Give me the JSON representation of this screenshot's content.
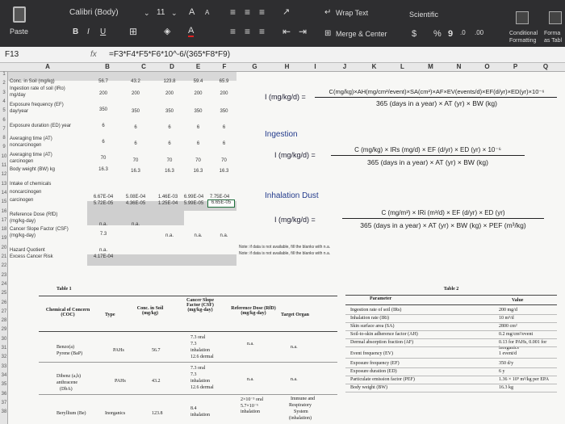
{
  "ribbon": {
    "paste_label": "Paste",
    "font_name": "Calibri (Body)",
    "font_size": "11",
    "grow_font": "A",
    "shrink_font": "A",
    "bold": "B",
    "italic": "I",
    "underline": "U",
    "wrap_text": "Wrap Text",
    "merge_center": "Merge & Center",
    "number_format": "Scientific",
    "currency": "$",
    "percent": "%",
    "comma": "9",
    "conditional_formatting_1": "Conditional",
    "conditional_formatting_2": "Formatting",
    "format_as_table_1": "Forma",
    "format_as_table_2": "as Tabl"
  },
  "formula_bar": {
    "cell_ref": "F13",
    "fx": "fx",
    "formula": "=F3*F4*F5*F6*10^-6/(365*F8*F9)"
  },
  "columns": [
    "A",
    "B",
    "C",
    "D",
    "E",
    "F",
    "G",
    "H",
    "I",
    "J",
    "K",
    "L",
    "M",
    "N",
    "O",
    "P",
    "Q"
  ],
  "rows": [
    "1",
    "2",
    "3",
    "4",
    "5",
    "6",
    "7",
    "8",
    "9",
    "10",
    "11",
    "12",
    "13",
    "14",
    "15",
    "16",
    "17",
    "18",
    "19",
    "20",
    "21",
    "22",
    "23",
    "24",
    "25",
    "26",
    "27",
    "28",
    "29",
    "30",
    "31",
    "32",
    "33",
    "34",
    "35",
    "36",
    "37",
    "38"
  ],
  "labels": {
    "r2": "Conc. in Soil (mg/kg)",
    "r3a": "Ingestion rate of soil (IRo)",
    "r3b": "mg/day",
    "r4a": "Exposure frequency (EF)",
    "r4b": "day/year",
    "r6": "Exposure duration (ED) year",
    "r7a": "Averaging time (AT)",
    "r7b": "noncarcinogen",
    "r8a": "Averaging time (AT)",
    "r8b": "carcinogen",
    "r9": "Body weight (BW) kg",
    "r11": "Intake of chemicals",
    "r12": "noncarcinogen",
    "r13": "carcinogen",
    "r15a": "Reference Dose (RfD)",
    "r15b": "(mg/kg-day)",
    "r16a": "Cancer Slope Factor (CSF)",
    "r16b": "(mg/kg-day)",
    "r18": "Hazard Quotient",
    "r19": "Excess Cancer Risk"
  },
  "values": {
    "r2": [
      "56.7",
      "43.2",
      "123.8",
      "59.4",
      "65.9"
    ],
    "r3": [
      "200",
      "200",
      "200",
      "200",
      "200"
    ],
    "r4": [
      "350",
      "350",
      "350",
      "350",
      "350"
    ],
    "r6": [
      "6",
      "6",
      "6",
      "6",
      "6"
    ],
    "r7": [
      "6",
      "6",
      "6",
      "6",
      "6"
    ],
    "r8": [
      "70",
      "70",
      "70",
      "70",
      "70"
    ],
    "r9": [
      "16.3",
      "16.3",
      "16.3",
      "16.3",
      "16.3"
    ],
    "r12": [
      "6.67E-04",
      "5.08E-04",
      "1.46E-03",
      "6.99E-04",
      "7.75E-04"
    ],
    "r13": [
      "5.72E-05",
      "4.36E-05",
      "1.25E-04",
      "5.99E-05",
      "6.65E-05"
    ],
    "r15": [
      "n.a.",
      "n.a."
    ],
    "r16": [
      "7.3",
      "n.a.",
      "n.a.",
      "n.a."
    ],
    "r18": "n.a.",
    "r19": "4.17E-04"
  },
  "notes": {
    "n1": "Note: if data is not available, fill the blanks with n.a.",
    "n2": "Note: if data is not available, fill the blanks with n.a."
  },
  "equations": {
    "main_lhs": "I (mg/kg/d) =",
    "main_num": "C(mg/kg)×AH(mg/cm²/event)×SA(cm²)×AF×EV(events/d)×EF(d/yr)×ED(yr)×10⁻⁶",
    "main_den": "365 (days in a year) × AT (yr) × BW (kg)",
    "ingestion_title": "Ingestion",
    "ing_lhs": "I (mg/kg/d) =",
    "ing_num": "C (mg/kg) × IRs (mg/d) × EF (d/yr) × ED (yr) × 10⁻⁶",
    "ing_den": "365 (days in a year) × AT (yr) × BW (kg)",
    "inhal_title": "Inhalation Dust",
    "inh_lhs": "I (mg/kg/d) =",
    "inh_num": "C (mg/m³) × IRi (m³/d) × EF (d/yr) × ED (yr)",
    "inh_den": "365 (days in a year) × AT (yr) × BW (kg) × PEF (m³/kg)"
  },
  "table1": {
    "title": "Table 1",
    "h_chem": "Chemical of Concern (COC)",
    "h_type": "Type",
    "h_conc": "Conc. in Soil (mg/kg)",
    "h_csf": "Cancer Slope Factor (CSF) (mg/kg-day)",
    "h_rfd": "Reference Dose (RfD) (mg/kg-day)",
    "h_target": "Target Organ",
    "r1_chem1": "Benzo(a)",
    "r1_chem2": "Pyrene (BaP)",
    "r1_type": "PAHs",
    "r1_conc": "56.7",
    "r1_csf1": "7.3 oral",
    "r1_csf2": "7.3",
    "r1_csf3": "inhalation",
    "r1_csf4": "12.6 dermal",
    "r1_rfd": "n.a.",
    "r1_target": "n.a.",
    "r2_chem1": "Dibenz (a,h)",
    "r2_chem2": "anthracene",
    "r2_chem3": "(DbA)",
    "r2_type": "PAHs",
    "r2_conc": "43.2",
    "r2_csf1": "7.3 oral",
    "r2_csf2": "7.3",
    "r2_csf3": "inhalation",
    "r2_csf4": "12.6 dermal",
    "r2_rfd": "n.a.",
    "r2_target": "n.a.",
    "r3_chem": "Beryllium (Be)",
    "r3_type": "Inorganics",
    "r3_conc": "123.8",
    "r3_csf1": "8.4",
    "r3_csf2": "inhalation",
    "r3_rfd1": "2×10⁻³ oral",
    "r3_rfd2": "5.7×10⁻⁶",
    "r3_rfd3": "inhalation",
    "r3_target1": "Immune and",
    "r3_target2": "Respiratory",
    "r3_target3": "System",
    "r3_target4": "(inhalation)"
  },
  "table2": {
    "title": "Table 2",
    "h_param": "Parameter",
    "h_value": "Value",
    "rows": [
      [
        "Ingestion rate of soil (IRs)",
        "200 mg/d"
      ],
      [
        "Inhalation rate (IRi)",
        "10 m³/d"
      ],
      [
        "Skin surface area (SA)",
        "2800 cm²"
      ],
      [
        "Soil-to-skin adherence factor (AH)",
        "0.2 mg/cm²/event"
      ],
      [
        "Dermal absorption fraction (AF)",
        "0.13 for PAHs, 0.001 for inorganics"
      ],
      [
        "Event frequency (EV)",
        "1 event/d"
      ],
      [
        "Exposure frequency (EF)",
        "350 d/y"
      ],
      [
        "Exposure duration (ED)",
        "6 y"
      ],
      [
        "Particulate emission factor (PEF)",
        "1.36 × 10⁹ m³/kg per EPA"
      ],
      [
        "Body weight (BW)",
        "16.3 kg"
      ]
    ]
  }
}
